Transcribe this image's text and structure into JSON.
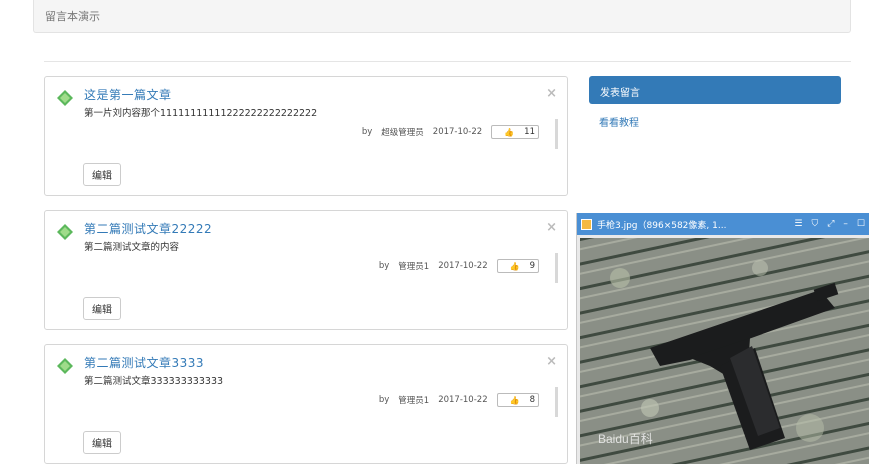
{
  "breadcrumb": "留言本演示",
  "posts": [
    {
      "title": "这是第一篇文章",
      "content": "第一片刘内容那个11111111111222222222222222",
      "by": "by",
      "author": "超级管理员",
      "date": "2017-10-22",
      "likes": "11",
      "edit_label": "编辑"
    },
    {
      "title": "第二篇测试文章22222",
      "content": "第二篇测试文章的内容",
      "by": "by",
      "author": "管理员1",
      "date": "2017-10-22",
      "likes": "9",
      "edit_label": "编辑"
    },
    {
      "title": "第二篇测试文章3333",
      "content": "第二篇测试文章333333333333",
      "by": "by",
      "author": "管理员1",
      "date": "2017-10-22",
      "likes": "8",
      "edit_label": "编辑"
    }
  ],
  "sidebar": {
    "active": "发表留言",
    "link": "看看教程"
  },
  "viewer": {
    "title": "手枪3.jpg（896×582像素, 1...",
    "icon": "image-file-icon",
    "watermark": "Baidu百科"
  },
  "icons": {
    "close": "×",
    "thumb": "thumbs-up-icon"
  },
  "colors": {
    "link": "#337ab7",
    "accent": "#337ab7",
    "viewer_bar": "#4a8fd4"
  }
}
